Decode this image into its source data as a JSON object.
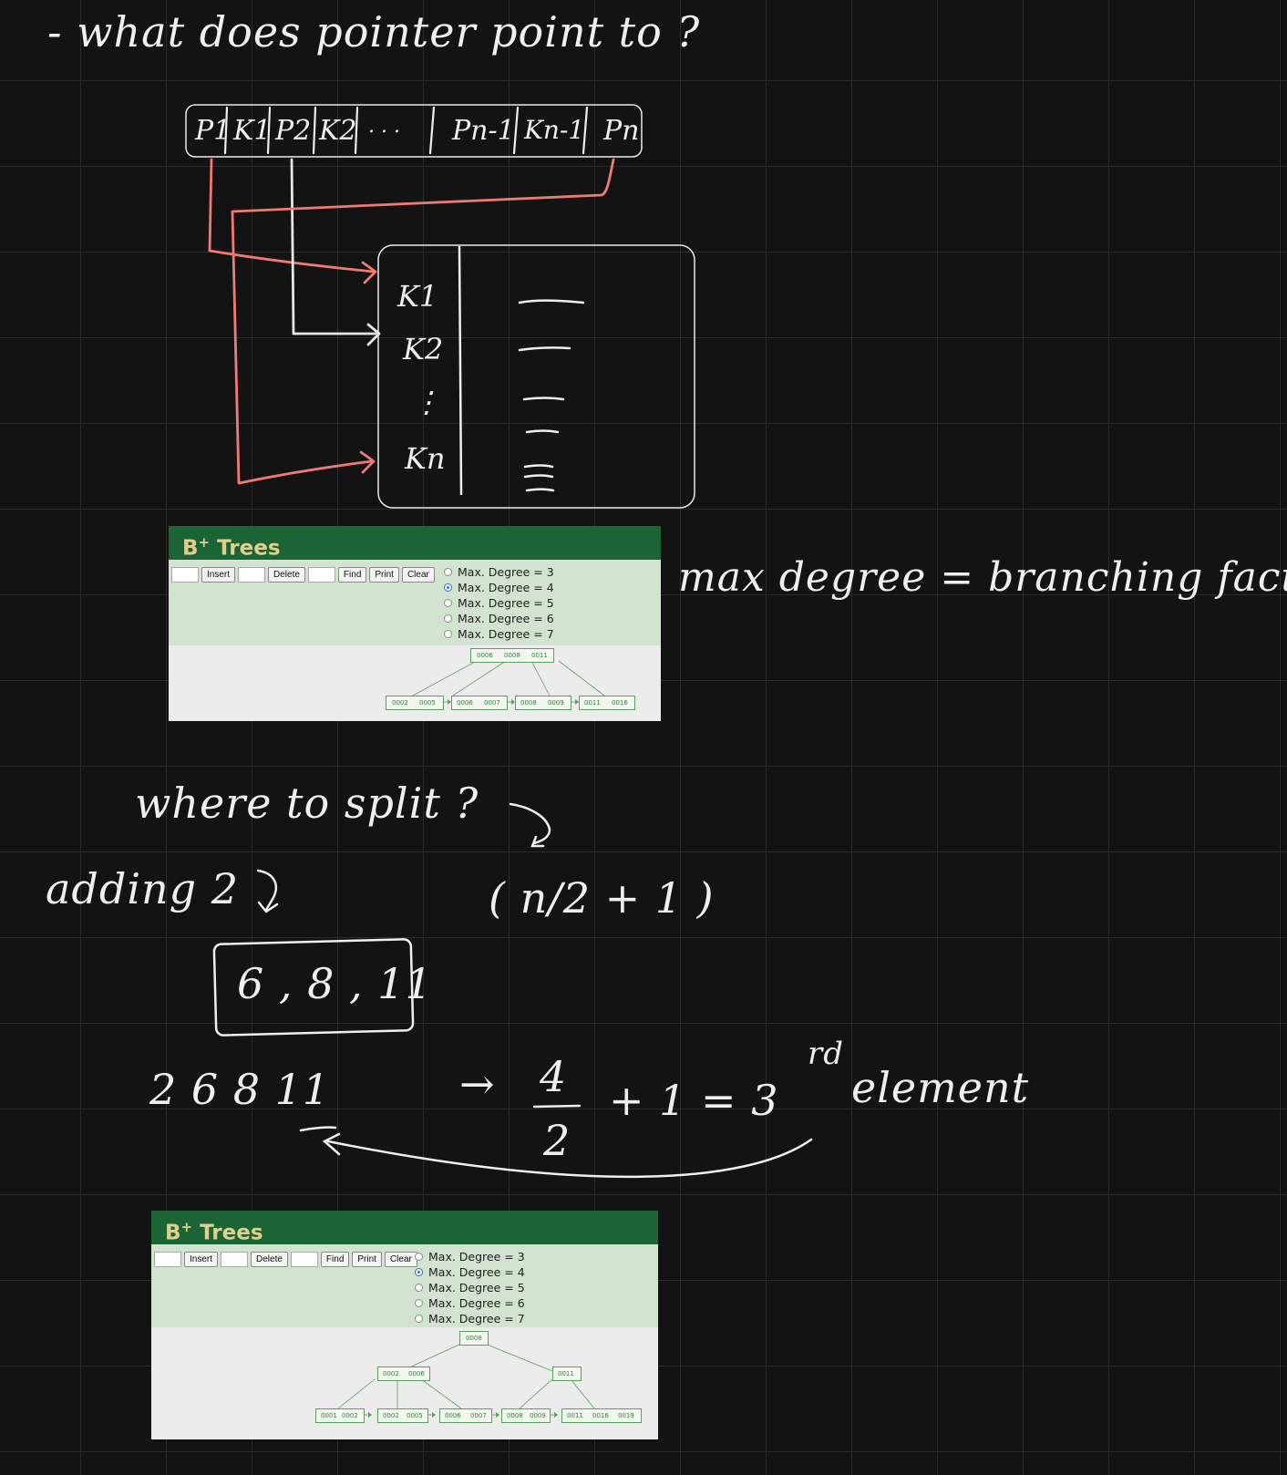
{
  "notes": {
    "question_pointer": "- what does pointer point to ?",
    "node_keys": {
      "p1": "P1",
      "k1": "K1",
      "p2": "P2",
      "k2": "K2",
      "dots": ". . .",
      "pn1": "Pn-1",
      "kn1": "Kn-1",
      "pn": "Pn"
    },
    "leaf_keys": {
      "k1": "K1",
      "k2": "K2",
      "dots": "⋮",
      "kn": "Kn"
    },
    "max_degree_note": "max degree = branching factor",
    "where_to_split": "where to split ?",
    "adding": "adding 2",
    "formula": "( n/2 + 1 )",
    "box_values": "6 , 8 , 11",
    "sequence": "2   6   8   11",
    "arrow": "→",
    "calc_num": "4",
    "calc_den": "2",
    "calc_rest": "+ 1 = 3",
    "ordinal": "rd",
    "element": "element"
  },
  "panels": [
    {
      "title": "B",
      "title_sup": "+",
      "title_rest": " Trees",
      "buttons": [
        "Insert",
        "Delete",
        "Find",
        "Print",
        "Clear"
      ],
      "radio_options": [
        "Max. Degree = 3",
        "Max. Degree = 4",
        "Max. Degree = 5",
        "Max. Degree = 6",
        "Max. Degree = 7"
      ],
      "selected": "Max. Degree = 4",
      "root": [
        "0006",
        "0008",
        "0011"
      ],
      "leaves": [
        [
          "0002",
          "0005"
        ],
        [
          "0006",
          "0007"
        ],
        [
          "0008",
          "0009"
        ],
        [
          "0011",
          "0016"
        ]
      ]
    },
    {
      "title": "B",
      "title_sup": "+",
      "title_rest": " Trees",
      "buttons": [
        "Insert",
        "Delete",
        "Find",
        "Print",
        "Clear"
      ],
      "radio_options": [
        "Max. Degree = 3",
        "Max. Degree = 4",
        "Max. Degree = 5",
        "Max. Degree = 6",
        "Max. Degree = 7"
      ],
      "selected": "Max. Degree = 4",
      "root": [
        "0008"
      ],
      "internal": [
        [
          "0002",
          "0006"
        ],
        [
          "0011"
        ]
      ],
      "leaves": [
        [
          "0001",
          "0002"
        ],
        [
          "0002",
          "0005"
        ],
        [
          "0006",
          "0007"
        ],
        [
          "0008",
          "0009"
        ],
        [
          "0011",
          "0016",
          "0019"
        ]
      ]
    }
  ],
  "colors": {
    "ink": "#efefef",
    "red_ink": "#f07a72",
    "header_green": "#1b6436",
    "header_text": "#e2cf8e",
    "control_green": "#d2e3cf",
    "tree_green": "#5aa05a"
  }
}
